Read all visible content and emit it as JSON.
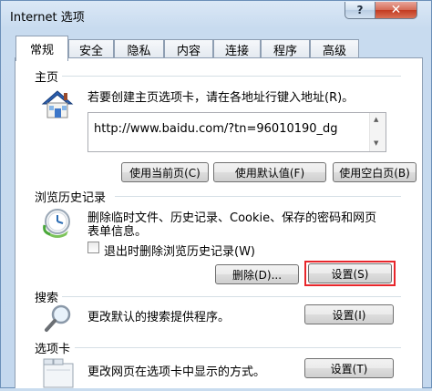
{
  "window": {
    "title": "Internet 选项",
    "help_label": "?",
    "close_label": "✕"
  },
  "tabs": [
    {
      "label": "常规",
      "active": true
    },
    {
      "label": "安全"
    },
    {
      "label": "隐私"
    },
    {
      "label": "内容"
    },
    {
      "label": "连接"
    },
    {
      "label": "程序"
    },
    {
      "label": "高级"
    }
  ],
  "homepage": {
    "title": "主页",
    "description": "若要创建主页选项卡，请在各地址行键入地址(R)。",
    "url": "http://www.baidu.com/?tn=96010190_dg",
    "buttons": {
      "use_current": "使用当前页(C)",
      "use_default": "使用默认值(F)",
      "use_blank": "使用空白页(B)"
    }
  },
  "history": {
    "title": "浏览历史记录",
    "description_line1": "删除临时文件、历史记录、Cookie、保存的密码和网页",
    "description_line2": "表单信息。",
    "checkbox_label": "退出时删除浏览历史记录(W)",
    "checkbox_checked": false,
    "delete_button": "删除(D)...",
    "settings_button": "设置(S)"
  },
  "search": {
    "title": "搜索",
    "description": "更改默认的搜索提供程序。",
    "settings_button": "设置(I)"
  },
  "tabs_section": {
    "title": "选项卡",
    "description": "更改网页在选项卡中显示的方式。",
    "settings_button": "设置(T)"
  },
  "colors": {
    "highlight": "#e8262b",
    "window_bg": "#c8dbef",
    "close_button": "#c33a20"
  }
}
